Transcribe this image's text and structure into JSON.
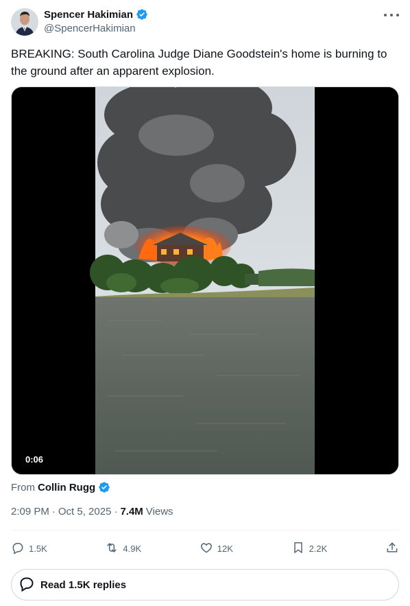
{
  "author": {
    "name": "Spencer Hakimian",
    "handle": "@SpencerHakimian",
    "verified": true
  },
  "tweet": {
    "text": "BREAKING: South Carolina Judge Diane Goodstein's home is burning to the ground after an apparent explosion."
  },
  "media": {
    "duration": "0:06"
  },
  "attribution": {
    "label": "From",
    "source": "Collin Rugg"
  },
  "meta": {
    "time": "2:09 PM",
    "separator1": "·",
    "date": "Oct 5, 2025",
    "separator2": "·",
    "views_count": "7.4M",
    "views_label": "Views"
  },
  "actions": {
    "replies": "1.5K",
    "reposts": "4.9K",
    "likes": "12K",
    "bookmarks": "2.2K"
  },
  "read_replies": {
    "label": "Read 1.5K replies"
  },
  "colors": {
    "accent": "#1d9bf0",
    "text_secondary": "#536471"
  }
}
